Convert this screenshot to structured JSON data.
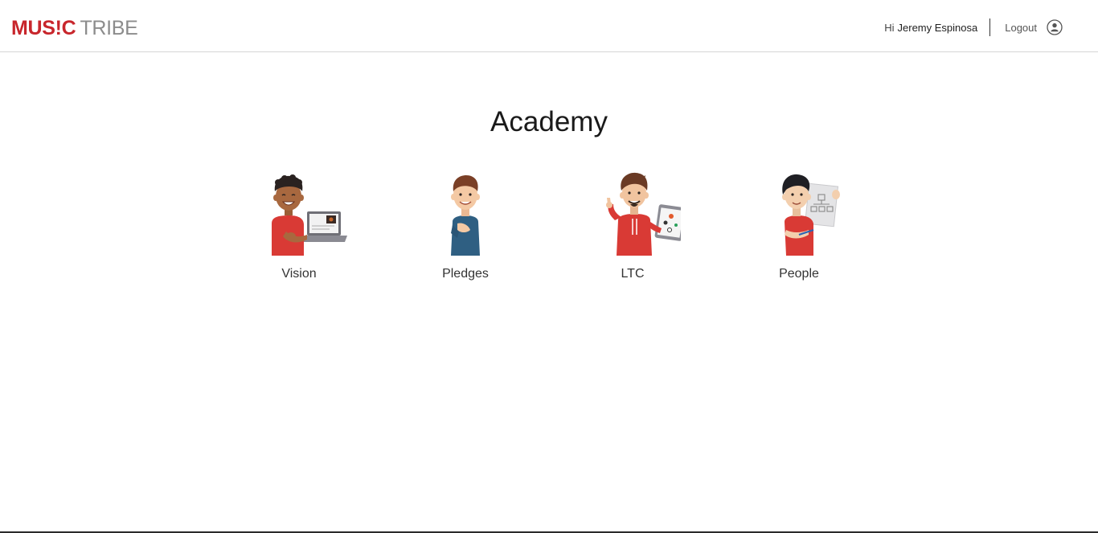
{
  "header": {
    "logo_music": "MUS!C",
    "logo_tribe": "TRIBE",
    "greeting_prefix": "Hi",
    "user_name": "Jeremy Espinosa",
    "logout_label": "Logout",
    "user_icon": "user-circle-icon"
  },
  "main": {
    "title": "Academy",
    "cards": [
      {
        "label": "Vision",
        "icon": "vision-illustration"
      },
      {
        "label": "Pledges",
        "icon": "pledges-illustration"
      },
      {
        "label": "LTC",
        "icon": "ltc-illustration"
      },
      {
        "label": "People",
        "icon": "people-illustration"
      }
    ]
  },
  "colors": {
    "brand_red": "#c8262c",
    "brand_grey": "#8c8c8c",
    "shirt_red": "#d93a35",
    "shirt_blue": "#2f5f82"
  }
}
